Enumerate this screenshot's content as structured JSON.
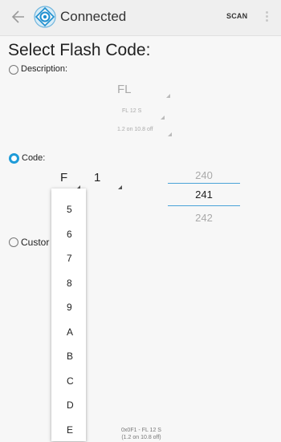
{
  "appbar": {
    "title": "Connected",
    "scan_label": "SCAN",
    "back_icon": "arrow-left-icon",
    "app_icon": "crosshair-target-icon",
    "menu_icon": "overflow-menu-icon"
  },
  "page_title": "Select Flash Code:",
  "description": {
    "label": "Description:",
    "selected": false,
    "spinner1": "FL",
    "spinner2": "FL 12 S",
    "spinner3": "1.2 on 10.8 off"
  },
  "code": {
    "label": "Code:",
    "selected": true,
    "letter_value": "F",
    "digit_value": "1",
    "number_picker": {
      "prev": "240",
      "current": "241",
      "next": "242"
    }
  },
  "custom": {
    "label": "Custor",
    "selected": false
  },
  "dropdown": {
    "items": [
      "5",
      "6",
      "7",
      "8",
      "9",
      "A",
      "B",
      "C",
      "D",
      "E"
    ]
  },
  "footer": {
    "line1": "0x0F1 - FL 12 S",
    "line2": "(1.2 on 10.8 off)"
  },
  "colors": {
    "accent": "#1e9bd8",
    "divider": "#4aa3d8"
  }
}
